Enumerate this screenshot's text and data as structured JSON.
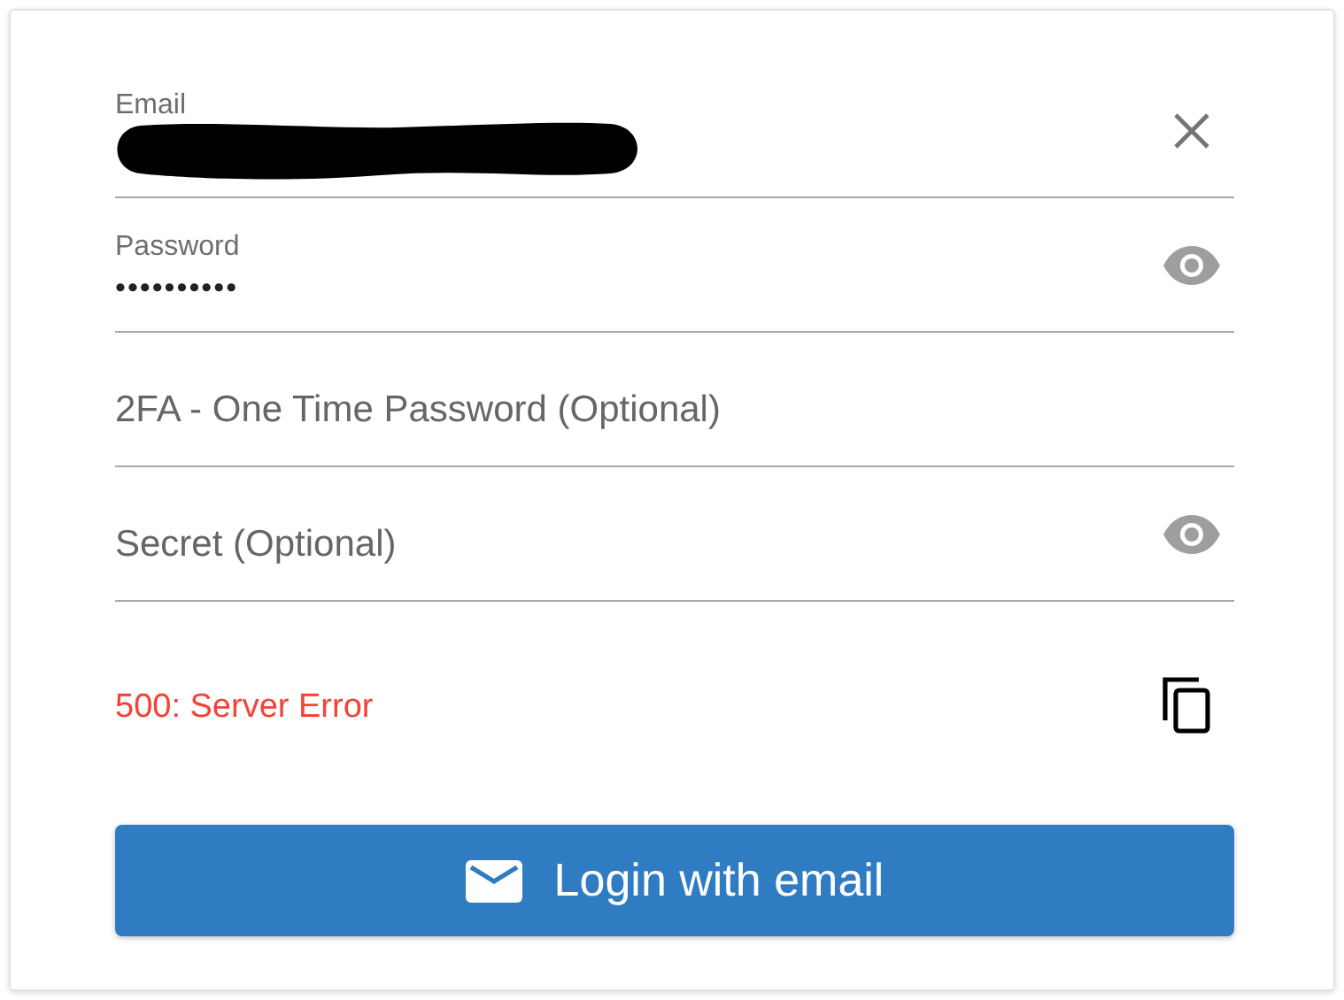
{
  "fields": [
    {
      "label": "Email",
      "redacted": true,
      "clearable": true
    },
    {
      "label": "Password",
      "value": "••••••••••",
      "revealable": true
    },
    {
      "placeholder": "2FA - One Time Password (Optional)"
    },
    {
      "placeholder": "Secret (Optional)",
      "revealable": true
    }
  ],
  "error": {
    "message": "500: Server Error"
  },
  "login_button": {
    "label": "Login with email"
  }
}
